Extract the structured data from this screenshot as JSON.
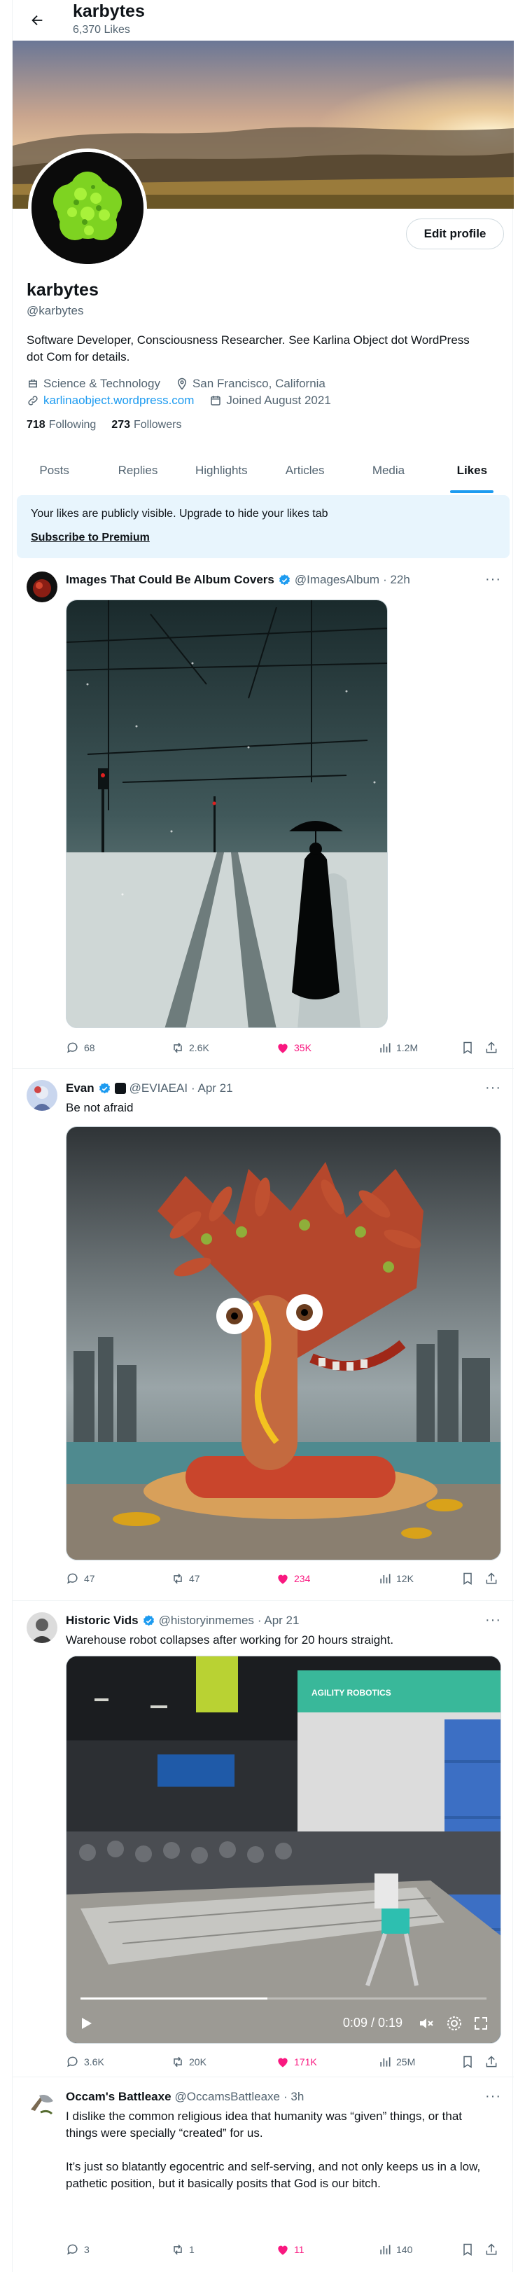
{
  "header": {
    "name": "karbytes",
    "likes_count": "6,370 Likes"
  },
  "profile": {
    "name": "karbytes",
    "handle": "@karbytes",
    "bio": "Software Developer, Consciousness Researcher. See Karlina Object dot WordPress dot Com for details.",
    "category": "Science & Technology",
    "location": "San Francisco, California",
    "website": "karlinaobject.wordpress.com",
    "joined": "Joined August 2021",
    "following_count": "718",
    "following_label": "Following",
    "followers_count": "273",
    "followers_label": "Followers",
    "edit_label": "Edit profile"
  },
  "tabs": [
    {
      "label": "Posts"
    },
    {
      "label": "Replies"
    },
    {
      "label": "Highlights"
    },
    {
      "label": "Articles"
    },
    {
      "label": "Media"
    },
    {
      "label": "Likes"
    }
  ],
  "active_tab": "Likes",
  "notice": {
    "text": "Your likes are publicly visible. Upgrade to hide your likes tab",
    "link": "Subscribe to Premium"
  },
  "posts": [
    {
      "name": "Images That Could Be Album Covers",
      "handle": "@ImagesAlbum",
      "time": "· 22h",
      "text": "",
      "replies": "68",
      "reposts": "2.6K",
      "likes": "35K",
      "views": "1.2M"
    },
    {
      "name": "Evan",
      "handle": "@EVIAEAI",
      "time": "· Apr 21",
      "text": "Be not afraid",
      "replies": "47",
      "reposts": "47",
      "likes": "234",
      "views": "12K"
    },
    {
      "name": "Historic Vids",
      "handle": "@historyinmemes",
      "time": "· Apr 21",
      "text": "Warehouse robot collapses after working for 20 hours straight.",
      "video_time": "0:09 / 0:19",
      "sign_text": "AGILITY ROBOTICS",
      "replies": "3.6K",
      "reposts": "20K",
      "likes": "171K",
      "views": "25M"
    },
    {
      "name": "Occam's Battleaxe",
      "handle": "@OccamsBattleaxe",
      "time": "· 3h",
      "text": "I dislike the common religious idea that humanity was “given” things, or that things were specially “created” for us.\n\nIt’s just so blatantly egocentric and self-serving, and not only keeps us in a low, pathetic position, but it basically posits that God is our bitch.",
      "replies": "3",
      "reposts": "1",
      "likes": "11",
      "views": "140"
    }
  ],
  "colors": {
    "accent": "#1d9bf0",
    "like": "#f91880",
    "muted": "#536471"
  }
}
